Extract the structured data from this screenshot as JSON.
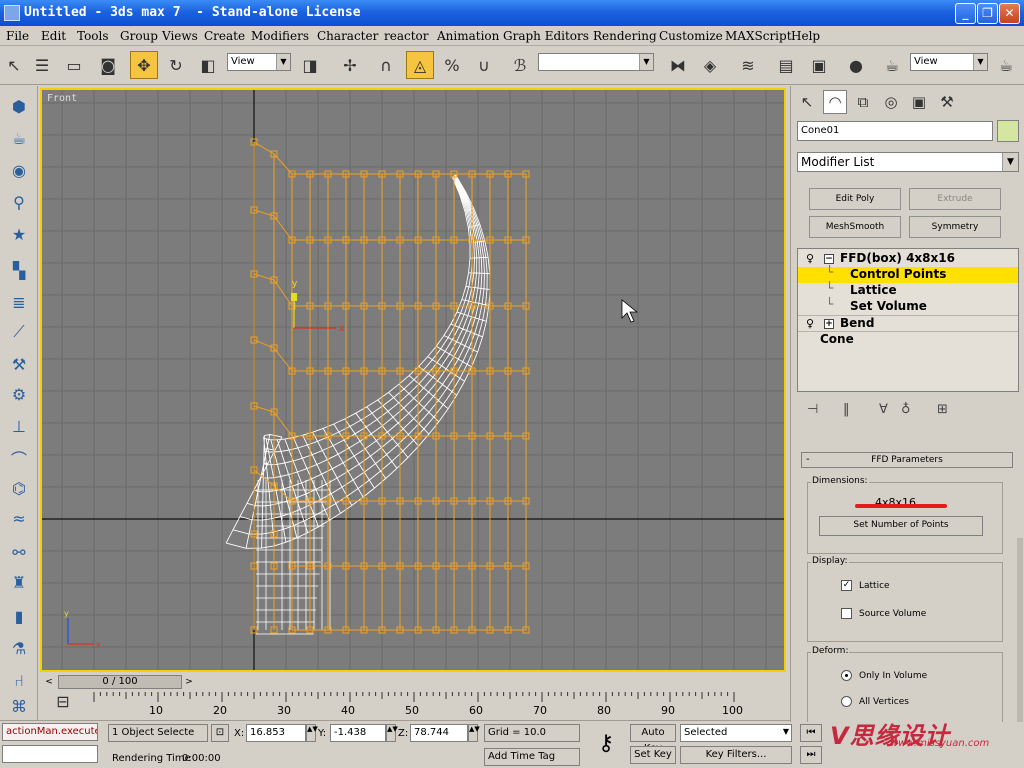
{
  "window": {
    "title": "Untitled - 3ds max 7  - Stand-alone License",
    "minimize": "_",
    "maximize": "❐",
    "close": "✕"
  },
  "menu": [
    "File",
    "Edit",
    "Tools",
    "Group",
    "Views",
    "Create",
    "Modifiers",
    "Character",
    "reactor",
    "Animation",
    "Graph Editors",
    "Rendering",
    "Customize",
    "MAXScript",
    "Help"
  ],
  "toolbar": {
    "ref_coord": "View",
    "named_selection": "",
    "render_view": "View"
  },
  "viewport": {
    "label": "Front",
    "axis_y": "y",
    "axis_x": "x",
    "grid_color": "#6a6a6a",
    "lattice_color": "#f0a020",
    "mesh_color": "#ffffff",
    "border_color": "#f5d000"
  },
  "timeline": {
    "frame": "0 / 100",
    "ticks": [
      "10",
      "20",
      "30",
      "40",
      "50",
      "60",
      "70",
      "80",
      "90",
      "100"
    ]
  },
  "status": {
    "maxscript": "actionMan.execute",
    "selection": "1 Object Selecte",
    "x_label": "X:",
    "x": "16.853",
    "y_label": "Y:",
    "y": "-1.438",
    "z_label": "Z:",
    "z": "78.744",
    "grid": "Grid = 10.0",
    "rendering_time_label": "Rendering Time",
    "rendering_time": "0:00:00",
    "add_time_tag": "Add Time Tag",
    "auto_key": "Auto Key",
    "set_key": "Set Key",
    "key_mode": "Selected",
    "key_filters": "Key Filters..."
  },
  "cmdpanel": {
    "object_name": "Cone01",
    "modifier_list": "Modifier List",
    "buttons": [
      {
        "label": "Edit Poly",
        "enabled": true
      },
      {
        "label": "Extrude",
        "enabled": false
      },
      {
        "label": "MeshSmooth",
        "enabled": true
      },
      {
        "label": "Symmetry",
        "enabled": true
      }
    ],
    "stack": [
      {
        "label": "FFD(box) 4x8x16"
      },
      {
        "label": "Control Points"
      },
      {
        "label": "Lattice"
      },
      {
        "label": "Set Volume"
      },
      {
        "label": "Bend"
      },
      {
        "label": "Cone"
      }
    ],
    "rollout": {
      "title": "FFD Parameters",
      "pm": "-",
      "dimensions_label": "Dimensions:",
      "dimensions_value": "4x8x16",
      "set_points_button": "Set Number of Points",
      "display_label": "Display:",
      "lattice": "Lattice",
      "lattice_checked": true,
      "source_volume": "Source Volume",
      "source_volume_checked": false,
      "deform_label": "Deform:",
      "only_in_volume": "Only In Volume",
      "all_vertices": "All Vertices"
    }
  },
  "watermark": {
    "text1": "V思缘设计",
    "text2": "www.missyuan.com"
  }
}
